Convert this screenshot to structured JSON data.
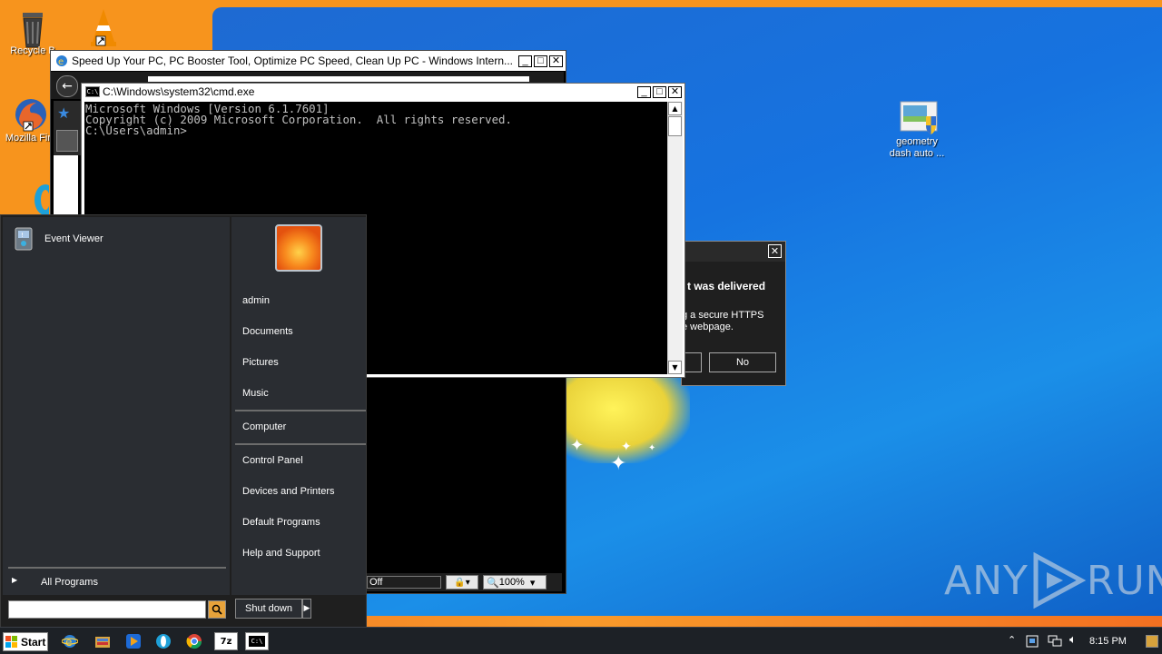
{
  "desktop": {
    "icons": [
      {
        "label": "Recycle Bin",
        "short": "Recycle B"
      },
      {
        "label": "VLC"
      },
      {
        "label": "Mozilla Firefox",
        "short": "Mozilla Fire"
      },
      {
        "label": "Opera"
      },
      {
        "label": "geometry dash auto ...",
        "line1": "geometry",
        "line2": "dash auto ..."
      }
    ]
  },
  "ie_window": {
    "title": "Speed Up Your PC, PC Booster Tool, Optimize PC Speed, Clean Up PC - Windows Intern...",
    "status_off": "Off",
    "zoom": "100%"
  },
  "cmd_window": {
    "title": "C:\\Windows\\system32\\cmd.exe",
    "line1": "Microsoft Windows [Version 6.1.7601]",
    "line2": "Copyright (c) 2009 Microsoft Corporation.  All rights reserved.",
    "line3": "",
    "line4": "C:\\Users\\admin>"
  },
  "dialog": {
    "heading_fragment": "t was delivered",
    "body_line1": "g a secure HTTPS",
    "body_line2": "e webpage.",
    "no_button": "No"
  },
  "start_menu": {
    "pinned": [
      {
        "label": "Event Viewer"
      }
    ],
    "all_programs": "All Programs",
    "right_items": [
      "admin",
      "Documents",
      "Pictures",
      "Music",
      "Computer",
      "Control Panel",
      "Devices and Printers",
      "Default Programs",
      "Help and Support"
    ],
    "shutdown": "Shut down",
    "search_placeholder": ""
  },
  "taskbar": {
    "start_label": "Start",
    "time": "8:15 PM"
  },
  "watermark": {
    "text_left": "ANY",
    "text_right": "RUN"
  },
  "colors": {
    "desktop_blue": "#1673e0",
    "wall_orange": "#f7941d",
    "taskbar": "#1d2126",
    "start_menu": "#2a2d32"
  }
}
